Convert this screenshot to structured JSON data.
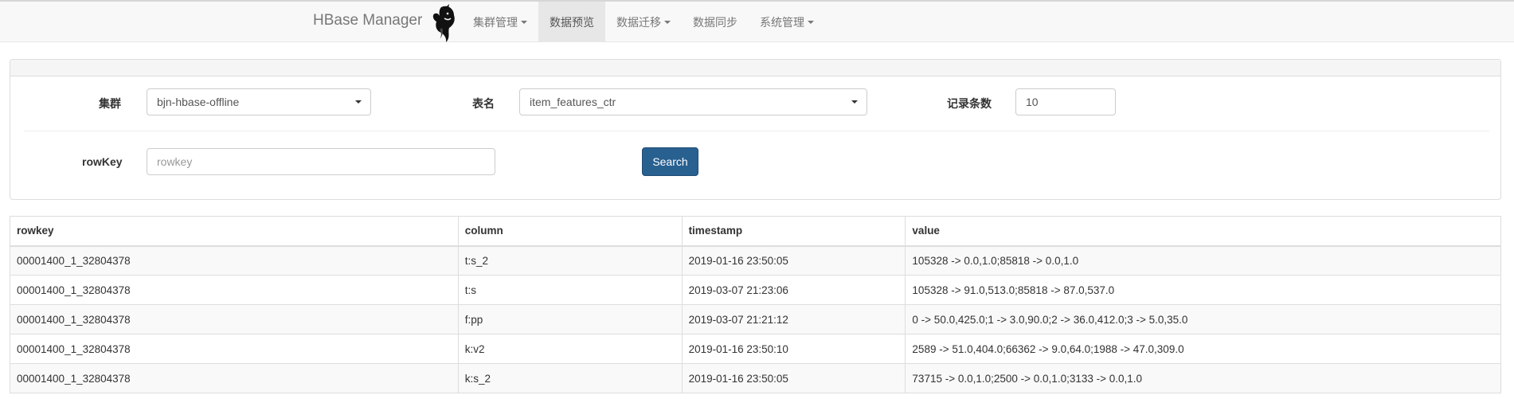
{
  "navbar": {
    "brand": "HBase Manager",
    "items": [
      {
        "label": "集群管理",
        "dropdown": true,
        "active": false
      },
      {
        "label": "数据预览",
        "dropdown": false,
        "active": true
      },
      {
        "label": "数据迁移",
        "dropdown": true,
        "active": false
      },
      {
        "label": "数据同步",
        "dropdown": false,
        "active": false
      },
      {
        "label": "系统管理",
        "dropdown": true,
        "active": false
      }
    ]
  },
  "form": {
    "cluster_label": "集群",
    "cluster_value": "bjn-hbase-offline",
    "table_label": "表名",
    "table_value": "item_features_ctr",
    "count_label": "记录条数",
    "count_value": "10",
    "rowkey_label": "rowKey",
    "rowkey_placeholder": "rowkey",
    "search_label": "Search"
  },
  "results": {
    "headers": [
      "rowkey",
      "column",
      "timestamp",
      "value"
    ],
    "rows": [
      [
        "00001400_1_32804378",
        "t:s_2",
        "2019-01-16 23:50:05",
        "105328 -> 0.0,1.0;85818 -> 0.0,1.0"
      ],
      [
        "00001400_1_32804378",
        "t:s",
        "2019-03-07 21:23:06",
        "105328 -> 91.0,513.0;85818 -> 87.0,537.0"
      ],
      [
        "00001400_1_32804378",
        "f:pp",
        "2019-03-07 21:21:12",
        "0 -> 50.0,425.0;1 -> 3.0,90.0;2 -> 36.0,412.0;3 -> 5.0,35.0"
      ],
      [
        "00001400_1_32804378",
        "k:v2",
        "2019-01-16 23:50:10",
        "2589 -> 51.0,404.0;66362 -> 9.0,64.0;1988 -> 47.0,309.0"
      ],
      [
        "00001400_1_32804378",
        "k:s_2",
        "2019-01-16 23:50:05",
        "73715 -> 0.0,1.0;2500 -> 0.0,1.0;3133 -> 0.0,1.0"
      ]
    ]
  }
}
